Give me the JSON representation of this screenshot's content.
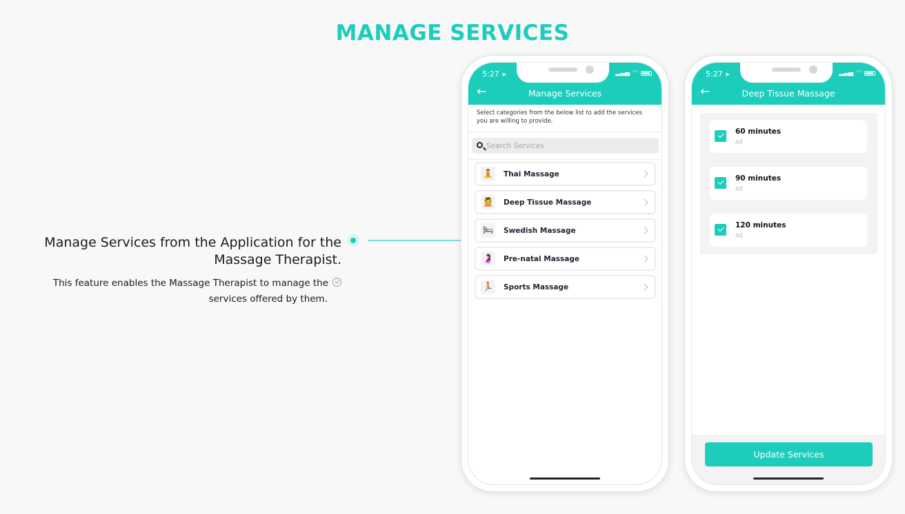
{
  "page": {
    "title": "MANAGE SERVICES"
  },
  "feature": {
    "heading_line1": "Manage Services from the Application for the",
    "heading_line2": "Massage Therapist.",
    "desc_line1": "This feature enables the Massage Therapist to manage the",
    "desc_line2": "services offered by them."
  },
  "colors": {
    "accent": "#1ccdbb",
    "background": "#f8f8f8"
  },
  "phone_a": {
    "status_time": "5:27",
    "title": "Manage Services",
    "intro": "Select categories from the below list to add the services you are willing to provide.",
    "search_placeholder": "Search Services",
    "services": [
      {
        "label": "Thai Massage",
        "icon": "thai-massage-icon"
      },
      {
        "label": "Deep Tissue Massage",
        "icon": "deep-tissue-massage-icon"
      },
      {
        "label": "Swedish Massage",
        "icon": "swedish-massage-icon"
      },
      {
        "label": "Pre-natal Massage",
        "icon": "pre-natal-massage-icon"
      },
      {
        "label": "Sports Massage",
        "icon": "sports-massage-icon"
      }
    ]
  },
  "phone_b": {
    "status_time": "5:27",
    "title": "Deep Tissue Massage",
    "options": [
      {
        "title": "60 minutes",
        "sub": "All",
        "checked": true
      },
      {
        "title": "90 minutes",
        "sub": "All",
        "checked": true
      },
      {
        "title": "120 minutes",
        "sub": "All",
        "checked": true
      }
    ],
    "update_label": "Update Services"
  }
}
